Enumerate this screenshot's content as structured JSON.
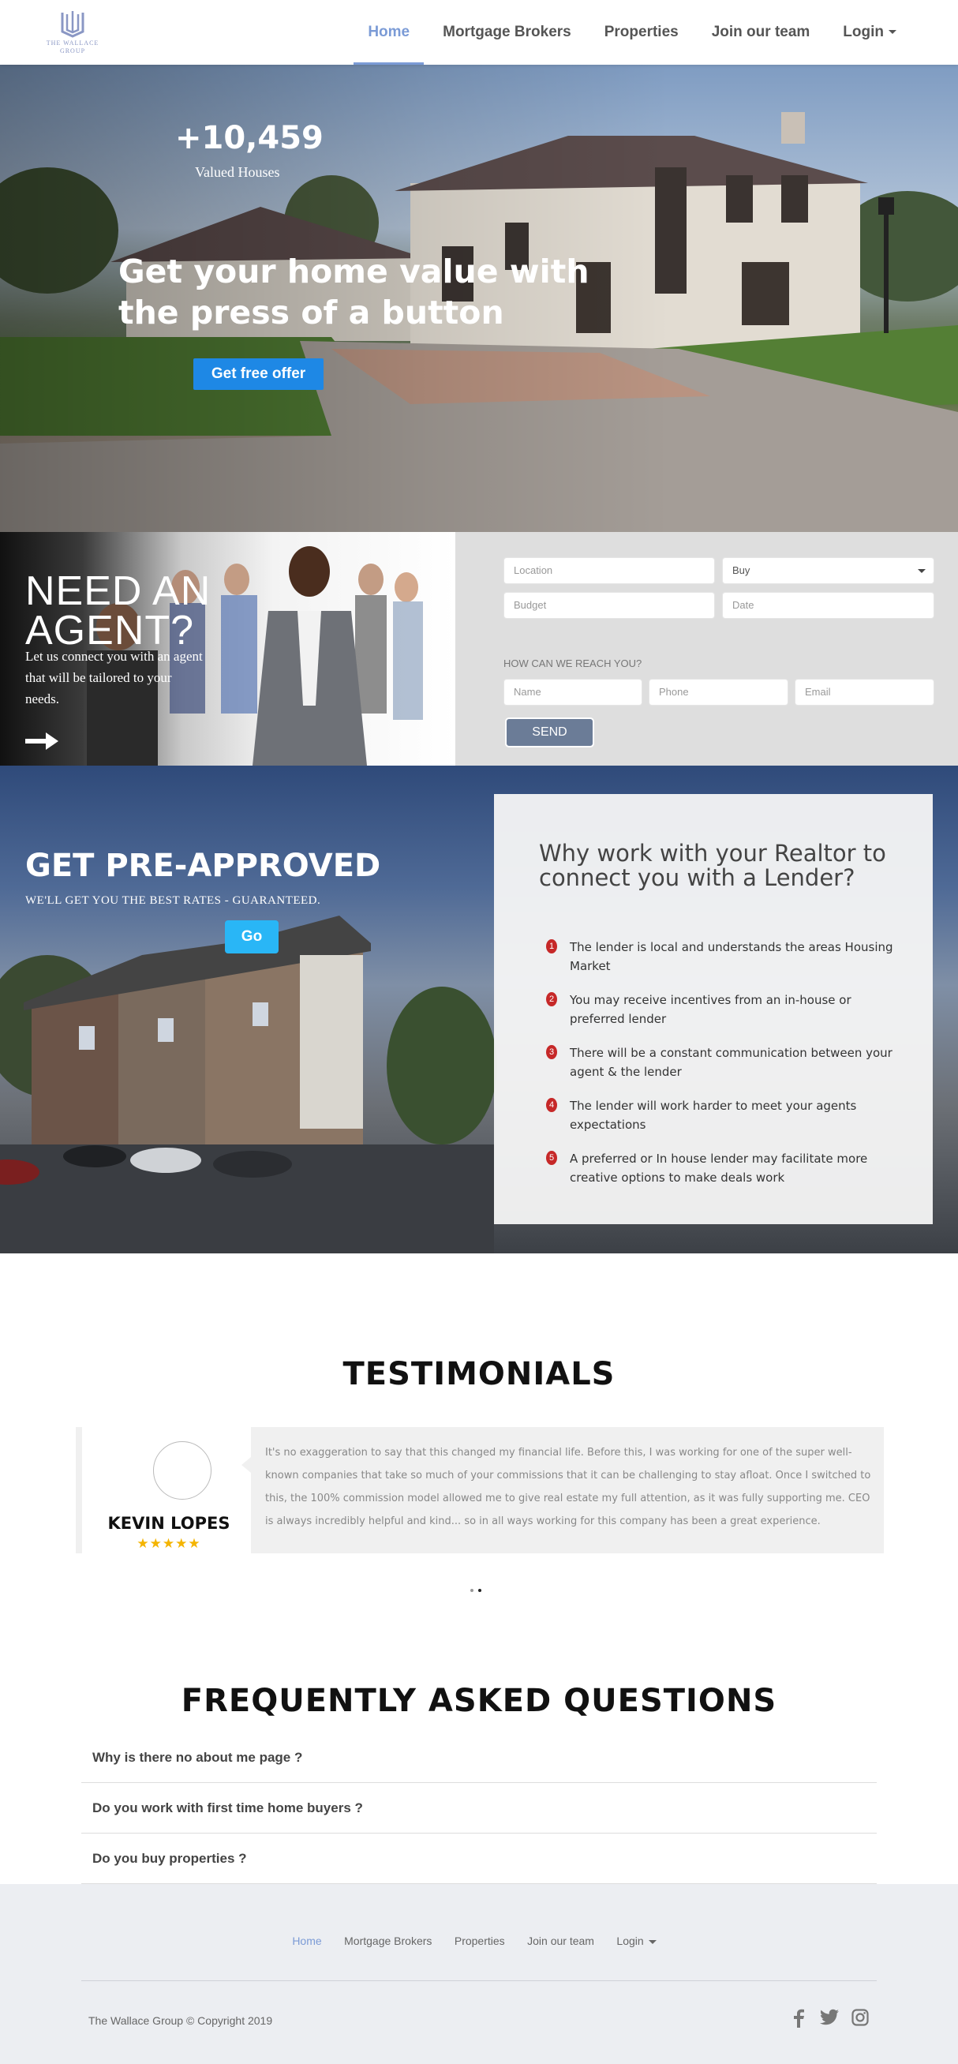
{
  "brand": {
    "logo_text": "THE WALLACE GROUP"
  },
  "nav": {
    "items": [
      {
        "label": "Home",
        "active": true
      },
      {
        "label": "Mortgage Brokers"
      },
      {
        "label": "Properties"
      },
      {
        "label": "Join our team"
      },
      {
        "label": "Login",
        "dropdown": true
      }
    ]
  },
  "hero": {
    "stat_number": "+10,459",
    "stat_label": "Valued Houses",
    "title": "Get your home value with the press of a button",
    "cta": "Get free offer"
  },
  "agent": {
    "title_line1": "NEED AN",
    "title_line2": "AGENT?",
    "text": "Let us connect you with an agent that will be tailored to your needs.",
    "form": {
      "location_placeholder": "Location",
      "type_value": "Buy",
      "budget_placeholder": "Budget",
      "date_placeholder": "Date",
      "contact_label": "HOW CAN WE REACH YOU?",
      "name_placeholder": "Name",
      "phone_placeholder": "Phone",
      "email_placeholder": "Email",
      "send_label": "SEND"
    }
  },
  "preapproved": {
    "title": "GET PRE-APPROVED",
    "subtitle": "WE'LL GET YOU THE BEST RATES - GUARANTEED.",
    "cta": "Go",
    "why_title": "Why work with your Realtor to connect you with a Lender?",
    "reasons": [
      "The lender is local and understands the areas Housing Market",
      "You may receive incentives from an in-house or preferred lender",
      "There will be a constant communication between your agent & the lender",
      "The lender will work harder to meet your agents expectations",
      "A preferred or In house lender may facilitate more creative options to make deals work"
    ]
  },
  "testimonials": {
    "title": "TESTIMONIALS",
    "name": "KEVIN LOPES",
    "stars": "★★★★★",
    "quote": "It's no exaggeration to say that this changed my financial life. Before this, I was working for one of the super well-known companies that take so much of your commissions that it can be challenging to stay afloat. Once I switched to this, the 100% commission model allowed me to give real estate my full attention, as it was fully supporting me. CEO is always incredibly helpful and kind... so in all ways working for this company has been a great experience."
  },
  "faq": {
    "title": "FREQUENTLY ASKED QUESTIONS",
    "questions": [
      "Why is there no about me page ?",
      "Do you work with first time home buyers ?",
      "Do you buy properties ?"
    ]
  },
  "footer": {
    "nav": [
      "Home",
      "Mortgage Brokers",
      "Properties",
      "Join our team",
      "Login"
    ],
    "copyright": "The Wallace Group © Copyright 2019",
    "social": [
      "facebook-icon",
      "twitter-icon",
      "instagram-icon"
    ]
  },
  "colors": {
    "accent": "#7b9bd6",
    "primary_button": "#1e88e5",
    "go_button": "#29b6f6",
    "badge": "#c62828"
  }
}
